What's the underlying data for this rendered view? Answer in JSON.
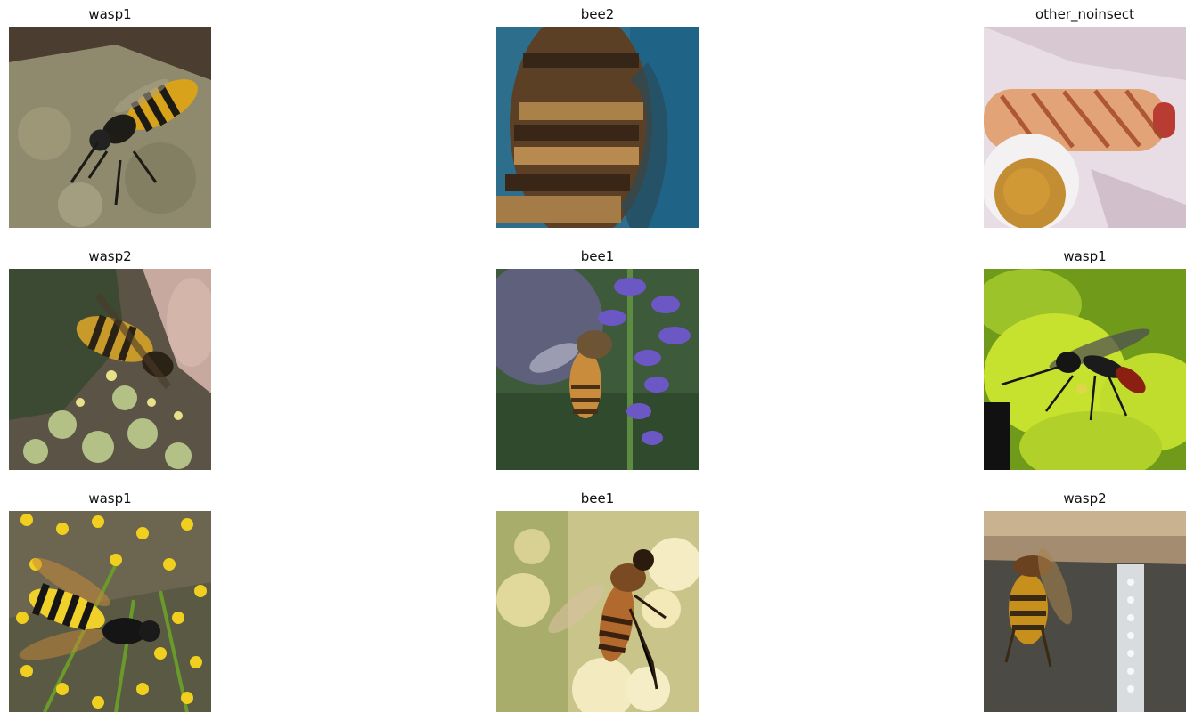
{
  "grid": [
    {
      "label": "wasp1",
      "scene": "wasp-on-rock",
      "icon": "wasp-photo"
    },
    {
      "label": "bee2",
      "scene": "bee-closeup-blue",
      "icon": "bee-photo"
    },
    {
      "label": "other_noinsect",
      "scene": "hotdog-mustard",
      "icon": "food-photo"
    },
    {
      "label": "wasp2",
      "scene": "wasp-on-ivy-flowers",
      "icon": "wasp-photo"
    },
    {
      "label": "bee1",
      "scene": "honeybee-on-lavender",
      "icon": "bee-photo"
    },
    {
      "label": "wasp1",
      "scene": "black-wasp-on-green-flower",
      "icon": "wasp-photo"
    },
    {
      "label": "wasp1",
      "scene": "wasp-on-yellow-fennel",
      "icon": "wasp-photo"
    },
    {
      "label": "bee1",
      "scene": "honeybee-on-cream-flowers",
      "icon": "bee-photo"
    },
    {
      "label": "wasp2",
      "scene": "hornet-on-wood-and-fabric",
      "icon": "wasp-photo"
    }
  ]
}
